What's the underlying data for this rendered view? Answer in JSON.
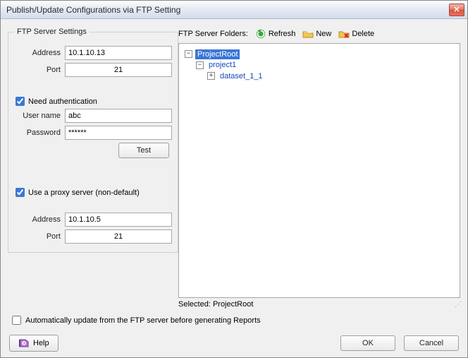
{
  "window": {
    "title": "Publish/Update Configurations via FTP Setting"
  },
  "server": {
    "legend": "FTP Server Settings",
    "address_label": "Address",
    "address": "10.1.10.13",
    "port_label": "Port",
    "port": "21",
    "need_auth_label": "Need authentication",
    "need_auth": true,
    "user_label": "User name",
    "user": "abc",
    "password_label": "Password",
    "password": "******",
    "test_label": "Test"
  },
  "proxy": {
    "use_label": "Use a proxy server (non-default)",
    "use": true,
    "address_label": "Address",
    "address": "10.1.10.5",
    "port_label": "Port",
    "port": "21"
  },
  "folders": {
    "label": "FTP Server Folders:",
    "refresh": "Refresh",
    "new": "New",
    "delete": "Delete",
    "selected_label": "Selected:",
    "selected": "ProjectRoot",
    "tree": {
      "root": "ProjectRoot",
      "child": "project1",
      "grandchild": "dataset_1_1"
    }
  },
  "auto_update_label": "Automatically update from the FTP server before generating Reports",
  "auto_update": false,
  "buttons": {
    "help": "Help",
    "ok": "OK",
    "cancel": "Cancel"
  }
}
